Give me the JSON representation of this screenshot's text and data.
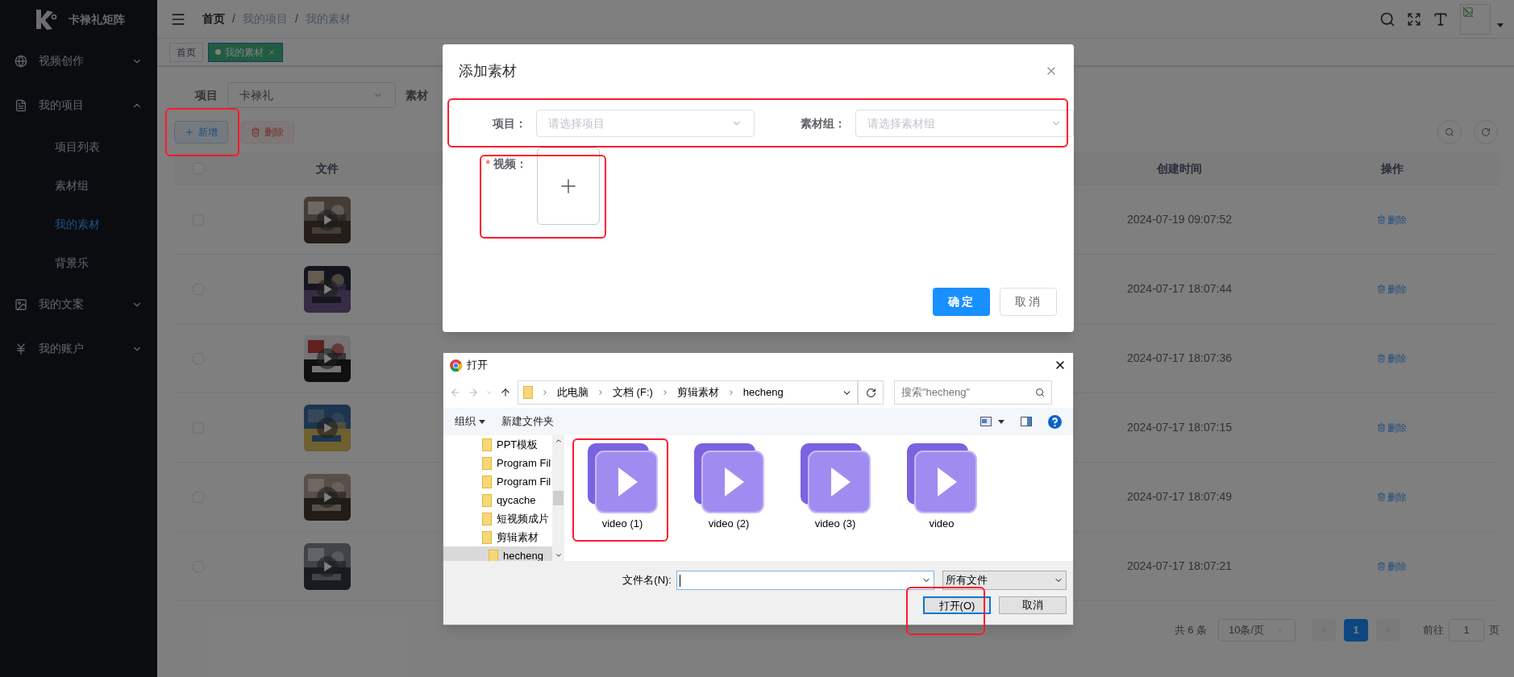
{
  "sidebar": {
    "brand": "卡禄礼矩阵",
    "items": [
      {
        "label": "视频创作",
        "expanded": false
      },
      {
        "label": "我的项目",
        "expanded": true,
        "children": [
          {
            "label": "项目列表",
            "selected": false
          },
          {
            "label": "素材组",
            "selected": false
          },
          {
            "label": "我的素材",
            "selected": true
          },
          {
            "label": "背景乐",
            "selected": false
          }
        ]
      },
      {
        "label": "我的文案",
        "expanded": false
      },
      {
        "label": "我的账户",
        "expanded": false
      }
    ]
  },
  "breadcrumb": [
    "首页",
    "我的项目",
    "我的素材"
  ],
  "breadcrumb_separator": "/",
  "tabs": [
    {
      "label": "首页",
      "selected": false
    },
    {
      "label": "我的素材",
      "selected": true
    }
  ],
  "filters": [
    {
      "label": "项目",
      "value": "卡禄礼"
    },
    {
      "label": "素材"
    }
  ],
  "actions": [
    {
      "label": "新增",
      "kind": "add",
      "disabled": false
    },
    {
      "label": "删除",
      "kind": "delete",
      "disabled": true
    }
  ],
  "table": {
    "all_checked": false,
    "columns": [
      "文件",
      "创建时间",
      "操作"
    ],
    "rows": [
      {
        "checked": false,
        "created": "2024-07-19 09:07:52",
        "action": "删除"
      },
      {
        "checked": false,
        "created": "2024-07-17 18:07:44",
        "action": "删除"
      },
      {
        "checked": false,
        "created": "2024-07-17 18:07:36",
        "action": "删除"
      },
      {
        "checked": false,
        "created": "2024-07-17 18:07:15",
        "action": "删除"
      },
      {
        "checked": false,
        "created": "2024-07-17 18:07:49",
        "action": "删除"
      },
      {
        "checked": false,
        "created": "2024-07-17 18:07:21",
        "action": "删除"
      }
    ]
  },
  "pagination": {
    "total": "共 6 条",
    "page_size": "10条/页",
    "pages": [
      {
        "label": "1",
        "selected": true
      }
    ],
    "goto": "前往",
    "page_input": "1",
    "page_unit": "页"
  },
  "add_dialog": {
    "title": "添加素材",
    "fields": [
      {
        "label": "项目：",
        "placeholder": "请选择项目"
      },
      {
        "label": "素材组：",
        "placeholder": "请选择素材组"
      }
    ],
    "video_label": "视频：",
    "required_mark": "*",
    "buttons": [
      {
        "label": "确定",
        "kind": "primary"
      },
      {
        "label": "取消",
        "kind": "default"
      }
    ]
  },
  "file_dialog": {
    "title": "打开",
    "path": [
      "此电脑",
      "文档 (F:)",
      "剪辑素材",
      "hecheng"
    ],
    "search_placeholder": "搜索\"hecheng\"",
    "toolbar": [
      "组织",
      "新建文件夹"
    ],
    "folders": [
      {
        "name": "PPT模板",
        "selected": false
      },
      {
        "name": "Program Fil",
        "selected": false
      },
      {
        "name": "Program Fil",
        "selected": false
      },
      {
        "name": "qycache",
        "selected": false
      },
      {
        "name": "短视频成片",
        "selected": false
      },
      {
        "name": "剪辑素材",
        "selected": false,
        "children": [
          {
            "name": "hecheng",
            "selected": true
          }
        ]
      }
    ],
    "files": [
      {
        "name": "video (1)"
      },
      {
        "name": "video (2)"
      },
      {
        "name": "video (3)"
      },
      {
        "name": "video"
      }
    ],
    "filename_label": "文件名(N):",
    "filetype": "所有文件",
    "buttons": [
      {
        "label": "打开(O)",
        "kind": "primary"
      },
      {
        "label": "取消",
        "kind": "default"
      }
    ]
  }
}
